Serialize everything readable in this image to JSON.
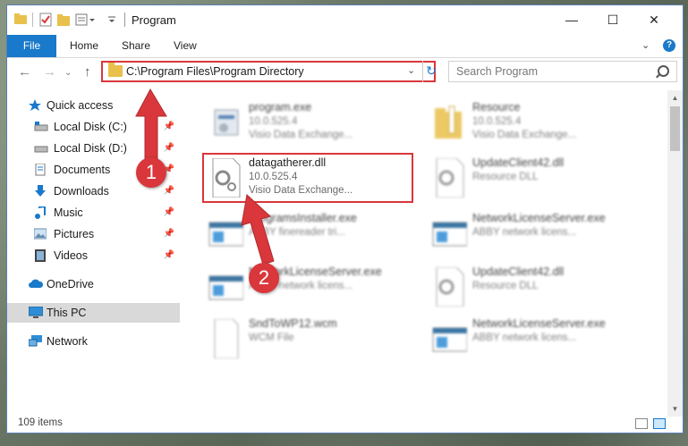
{
  "window": {
    "title": "Program",
    "minimize": "—",
    "maximize": "☐",
    "close": "✕"
  },
  "ribbon": {
    "file": "File",
    "home": "Home",
    "share": "Share",
    "view": "View",
    "help": "?"
  },
  "nav": {
    "address": "C:\\Program Files\\Program Directory",
    "search_placeholder": "Search Program"
  },
  "sidebar": {
    "items": [
      {
        "label": "Quick access",
        "icon": "star-icon"
      },
      {
        "label": "Local Disk (C:)",
        "icon": "drive-icon",
        "pinned": true
      },
      {
        "label": "Local Disk (D:)",
        "icon": "drive-icon",
        "pinned": true
      },
      {
        "label": "Documents",
        "icon": "documents-icon",
        "pinned": true
      },
      {
        "label": "Downloads",
        "icon": "downloads-icon",
        "pinned": true
      },
      {
        "label": "Music",
        "icon": "music-icon",
        "pinned": true
      },
      {
        "label": "Pictures",
        "icon": "pictures-icon",
        "pinned": true
      },
      {
        "label": "Videos",
        "icon": "videos-icon",
        "pinned": true
      },
      {
        "label": "OneDrive",
        "icon": "onedrive-icon"
      },
      {
        "label": "This PC",
        "icon": "pc-icon",
        "selected": true
      },
      {
        "label": "Network",
        "icon": "network-icon"
      }
    ]
  },
  "files": [
    {
      "name": "program.exe",
      "version": "10.0.525.4",
      "desc": "Visio Data Exchange...",
      "icon": "exe-icon",
      "blurred": true
    },
    {
      "name": "Resource",
      "version": "10.0.525.4",
      "desc": "Visio Data Exchange...",
      "icon": "folder-icon",
      "blurred": true
    },
    {
      "name": "datagatherer.dll",
      "version": "10.0.525.4",
      "desc": "Visio Data Exchange...",
      "icon": "dll-icon",
      "blurred": false,
      "highlighted": true
    },
    {
      "name": "UpdateClient42.dll",
      "version": "Resource DLL",
      "desc": "",
      "icon": "dll-icon",
      "blurred": true
    },
    {
      "name": "ProgramsInstaller.exe",
      "version": "ABBY finereader tri...",
      "desc": "",
      "icon": "window-icon",
      "blurred": true
    },
    {
      "name": "NetworkLicenseServer.exe",
      "version": "ABBY network licens...",
      "desc": "",
      "icon": "window-icon",
      "blurred": true
    },
    {
      "name": "NetworkLicenseServer.exe",
      "version": "ABBY network licens...",
      "desc": "",
      "icon": "window-icon",
      "blurred": true
    },
    {
      "name": "UpdateClient42.dll",
      "version": "Resource DLL",
      "desc": "",
      "icon": "dll-icon",
      "blurred": true
    },
    {
      "name": "SndToWP12.wcm",
      "version": "WCM File",
      "desc": "",
      "icon": "blank-file-icon",
      "blurred": true
    },
    {
      "name": "NetworkLicenseServer.exe",
      "version": "ABBY network licens...",
      "desc": "",
      "icon": "window-icon",
      "blurred": true
    }
  ],
  "status": {
    "count": "109 items"
  },
  "annotations": {
    "step1": "1",
    "step2": "2"
  },
  "colors": {
    "accent": "#1979ca",
    "highlight": "#d9373b",
    "folder": "#e9c04b"
  }
}
